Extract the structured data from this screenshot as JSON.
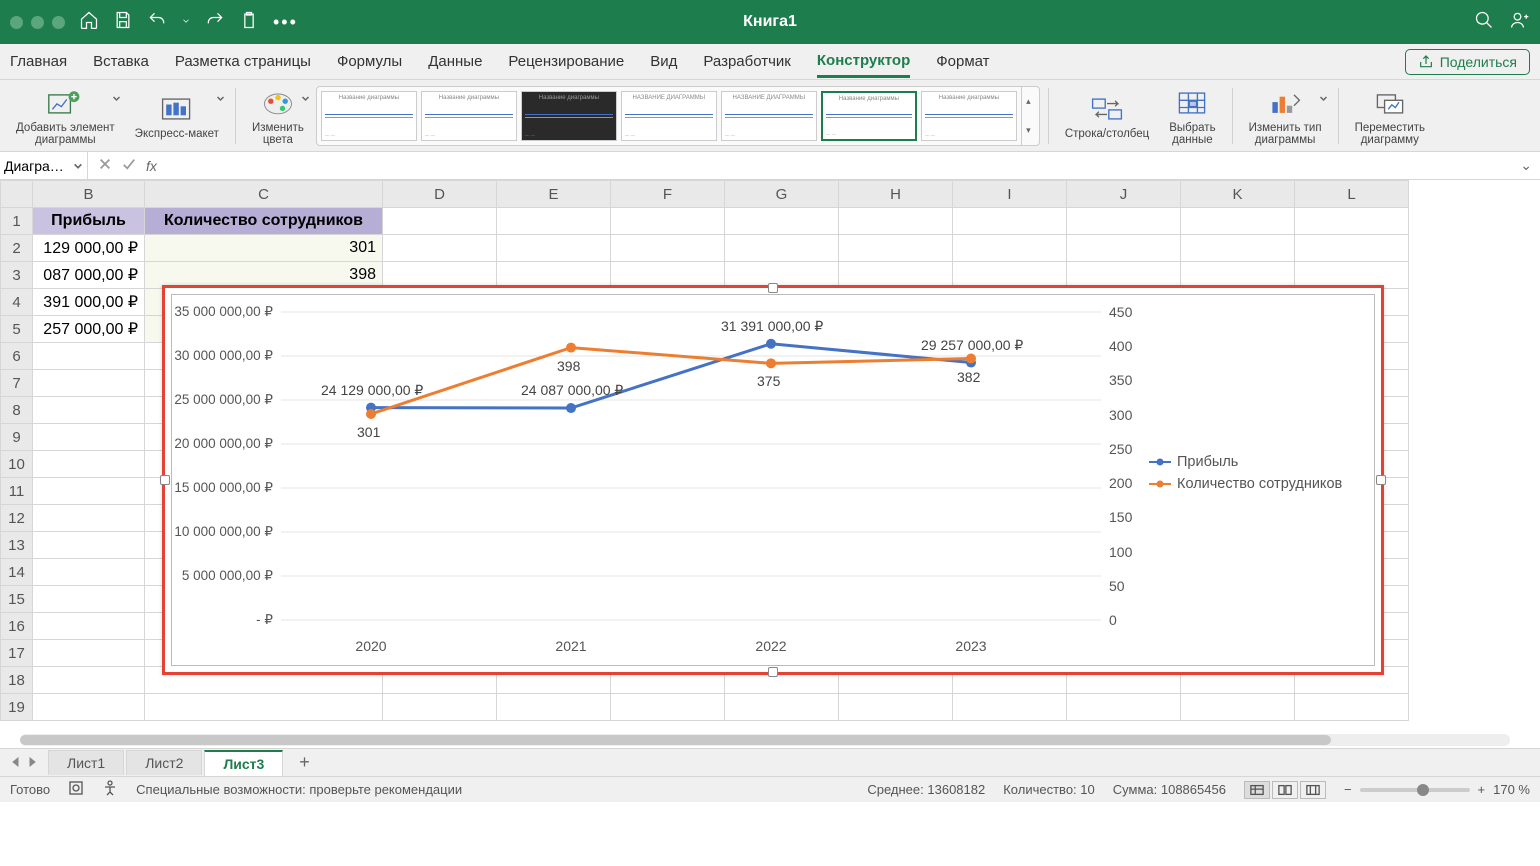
{
  "titlebar": {
    "title": "Книга1"
  },
  "ribbon_tabs": [
    "Главная",
    "Вставка",
    "Разметка страницы",
    "Формулы",
    "Данные",
    "Рецензирование",
    "Вид",
    "Разработчик",
    "Конструктор",
    "Формат"
  ],
  "active_tab": "Конструктор",
  "share_label": "Поделиться",
  "ribbon": {
    "add_element": "Добавить элемент\nдиаграммы",
    "quick_layout": "Экспресс-макет",
    "change_colors": "Изменить\nцвета",
    "switch_rowcol": "Строка/столбец",
    "select_data": "Выбрать\nданные",
    "change_type": "Изменить тип\nдиаграммы",
    "move_chart": "Переместить\nдиаграмму",
    "style_thumb_title": "Название диаграммы",
    "style_thumb_title_caps": "НАЗВАНИЕ ДИАГРАММЫ"
  },
  "formula_bar": {
    "namebox": "Диаграм…",
    "formula": ""
  },
  "columns": [
    "B",
    "C",
    "D",
    "E",
    "F",
    "G",
    "H",
    "I",
    "J",
    "K",
    "L"
  ],
  "rows": [
    "1",
    "2",
    "3",
    "4",
    "5",
    "6",
    "7",
    "8",
    "9",
    "10",
    "11",
    "12",
    "13",
    "14",
    "15",
    "16",
    "17",
    "18",
    "19"
  ],
  "data": {
    "b_header": "Прибыль",
    "c_header": "Количество сотрудников",
    "b": [
      "129 000,00 ₽",
      "087 000,00 ₽",
      "391 000,00 ₽",
      "257 000,00 ₽"
    ],
    "c": [
      "301",
      "398",
      "",
      "",
      ""
    ]
  },
  "chart_data": {
    "type": "line",
    "categories": [
      "2020",
      "2021",
      "2022",
      "2023"
    ],
    "series": [
      {
        "name": "Прибыль",
        "axis": "left",
        "color": "#4472c4",
        "values": [
          24129000,
          24087000,
          31391000,
          29257000
        ],
        "labels": [
          "24 129 000,00 ₽",
          "24 087 000,00 ₽",
          "31 391 000,00 ₽",
          "29 257 000,00 ₽"
        ]
      },
      {
        "name": "Количество сотрудников",
        "axis": "right",
        "color": "#ed7d31",
        "values": [
          301,
          398,
          375,
          382
        ],
        "labels": [
          "301",
          "398",
          "375",
          "382"
        ]
      }
    ],
    "y_left": {
      "min": 0,
      "max": 35000000,
      "ticks": [
        "-   ₽",
        "5 000 000,00 ₽",
        "10 000 000,00 ₽",
        "15 000 000,00 ₽",
        "20 000 000,00 ₽",
        "25 000 000,00 ₽",
        "30 000 000,00 ₽",
        "35 000 000,00 ₽"
      ]
    },
    "y_right": {
      "min": 0,
      "max": 450,
      "ticks": [
        "0",
        "50",
        "100",
        "150",
        "200",
        "250",
        "300",
        "350",
        "400",
        "450"
      ]
    }
  },
  "sheets": [
    "Лист1",
    "Лист2",
    "Лист3"
  ],
  "active_sheet": "Лист3",
  "status": {
    "ready": "Готово",
    "accessibility": "Специальные возможности: проверьте рекомендации",
    "average_label": "Среднее:",
    "average_value": "13608182",
    "count_label": "Количество:",
    "count_value": "10",
    "sum_label": "Сумма:",
    "sum_value": "108865456",
    "zoom": "170 %"
  }
}
